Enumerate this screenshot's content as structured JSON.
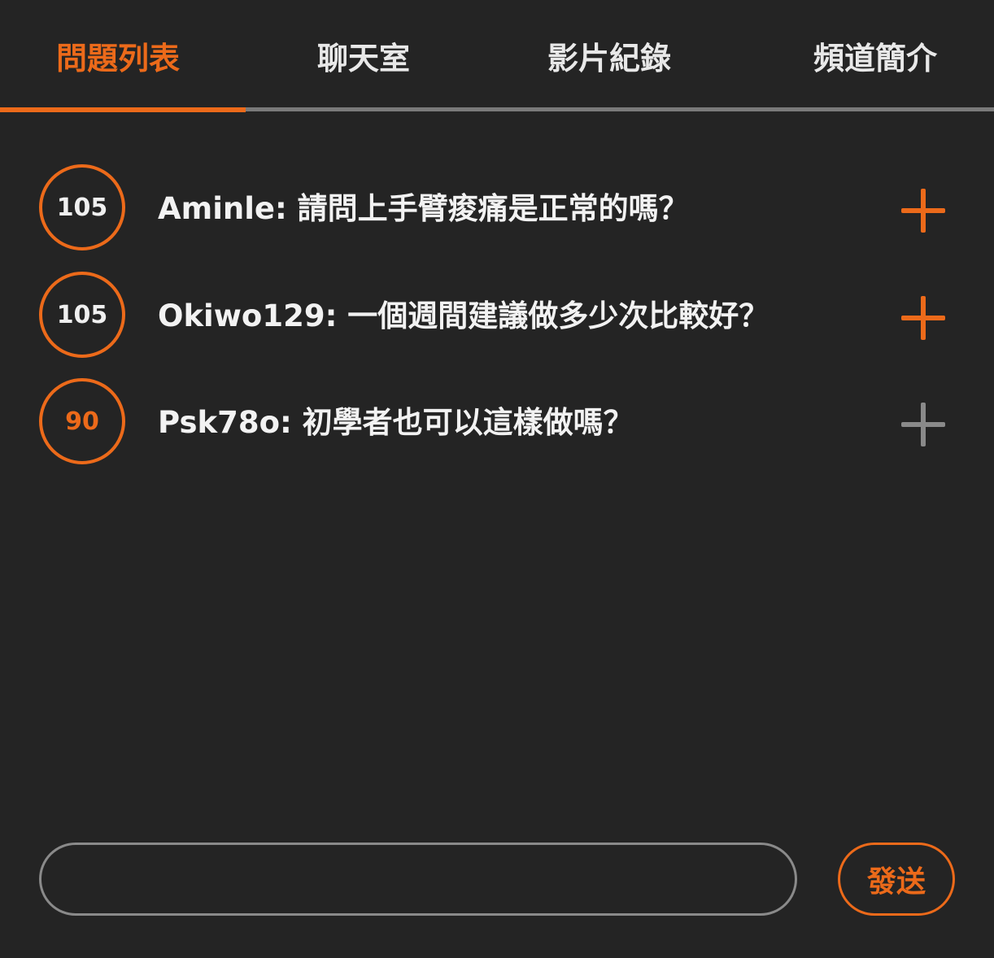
{
  "tabs": [
    {
      "label": "問題列表",
      "active": true
    },
    {
      "label": "聊天室",
      "active": false
    },
    {
      "label": "影片紀錄",
      "active": false
    },
    {
      "label": "頻道簡介",
      "active": false
    }
  ],
  "questions": [
    {
      "count": "105",
      "text": "Aminle: 請問上手臂痠痛是正常的嗎？",
      "plus_state": "active"
    },
    {
      "count": "105",
      "text": "Okiwo129: 一個週間建議做多少次比較好？",
      "plus_state": "active"
    },
    {
      "count": "90",
      "text": "Psk78o: 初學者也可以這樣做嗎？",
      "plus_state": "inactive"
    }
  ],
  "composer": {
    "placeholder": "",
    "send_label": "發送"
  },
  "colors": {
    "accent": "#ec6a1a",
    "background": "#242424",
    "muted": "#8a8a8a",
    "text": "#f2f2f2"
  }
}
